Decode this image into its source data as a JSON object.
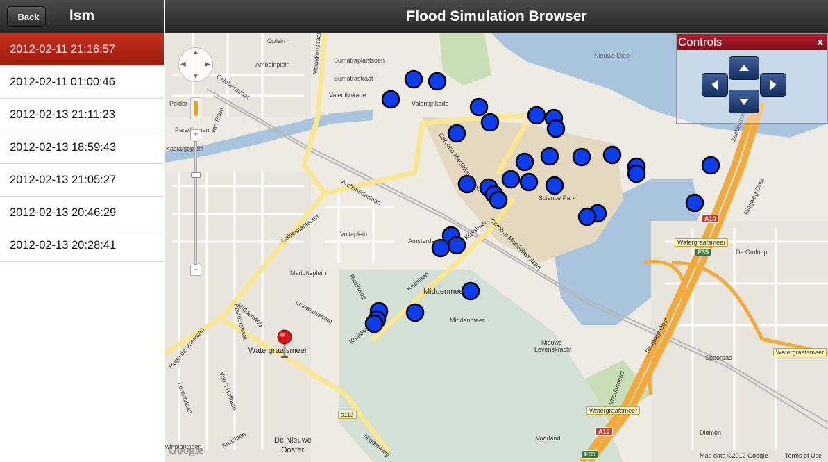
{
  "sidebar": {
    "back_label": "Back",
    "title": "lsm",
    "items": [
      {
        "label": "2012-02-11 21:16:57",
        "selected": true
      },
      {
        "label": "2012-02-11 01:00:46",
        "selected": false
      },
      {
        "label": "2012-02-13 21:11:23",
        "selected": false
      },
      {
        "label": "2012-02-13 18:59:43",
        "selected": false
      },
      {
        "label": "2012-02-13 21:05:27",
        "selected": false
      },
      {
        "label": "2012-02-13 20:46:29",
        "selected": false
      },
      {
        "label": "2012-02-13 20:28:41",
        "selected": false
      }
    ]
  },
  "header": {
    "title": "Flood Simulation Browser"
  },
  "controls": {
    "title": "Controls",
    "close_label": "x"
  },
  "map": {
    "labels": {
      "oostelijk": "Nieuwe Diep",
      "oplein": "Oplein",
      "amboinplein": "Amboinplein",
      "sumatraplantsoen": "Sumatraplantsoen",
      "sumatrastraat": "Sumatrastraat",
      "valentijnkade1": "Valentijnkade",
      "valentijnkade2": "Valentijnkade",
      "celebesstraat": "Celebesstraat",
      "polder": "Polder",
      "vaneden": "van Eden",
      "paradijslaan": "Paradijslaan",
      "kastanjeplein": "Kastanjeplein",
      "molukkenstraat": "Molukkenstraat",
      "carolina1": "Carolina MacGillavrylaan",
      "carolina2": "Carolina MacGillavrylaan",
      "sciencepark": "Science Park",
      "amsterdamsci": "Amsterdam Science",
      "archimedeslaan": "Archimedeslaan",
      "voltaplein": "Voltaplein",
      "kruislaan1": "Kruislaan",
      "kruislaan2": "Kruislaan",
      "kruislaan3": "Kruislaan",
      "kruislaan4": "Kruislaan",
      "middenmeer": "Middenmeer",
      "middenmeer2": "Middenmeer",
      "middenweg1": "Middenweg",
      "middenweg2": "Middenweg",
      "watergraafsmeer": "Watergraafsmeer",
      "galileiplantsoen": "Galileiplantsoen",
      "linnaeusstraat": "Linnaeusstraat",
      "mariotteplein": "Mariotteplein",
      "radioweg": "Radioweg",
      "hugodevrieslaan": "Hugo de Vrieslaan",
      "pasteurstraat": "Pasteurstraat",
      "lorentzlaan": "Lorentzlaan",
      "vanthoffstraat": "Van 't Hofflaan",
      "denieuweooster1": "De Nieuwe",
      "denieuweooster2": "Ooster",
      "nieuwe": "Nieuwe",
      "levenskracht": "Levenskracht",
      "ringwegoost1": "Ringweg Oost",
      "ringwegoost2": "Ringweg Oost",
      "spoorpad": "Spoorpad",
      "deomloop": "De Omloop",
      "voorland": "Voorland",
      "voorlandpad": "Voorlandpad",
      "diemen": "Diemen",
      "zeeburgerweg": "Zeeburgerw",
      "s113": "s113",
      "a10a": "A10",
      "a10b": "A10",
      "e35a": "E35",
      "e35b": "E35",
      "wsign1": "Watergraafsmeer",
      "wsign2": "Watergraafsmeer",
      "wsign3": "Watergraafsmeer",
      "vinplantsoen": "winplantsoen"
    },
    "google_logo": "Google",
    "attribution": "Map data ©2012 Google",
    "terms": "Terms of Use"
  },
  "colors": {
    "accent": "#b8202d",
    "marker_blue": "#0a3cf0",
    "water": "#a9c5dd",
    "highway": "#f4a93a"
  }
}
